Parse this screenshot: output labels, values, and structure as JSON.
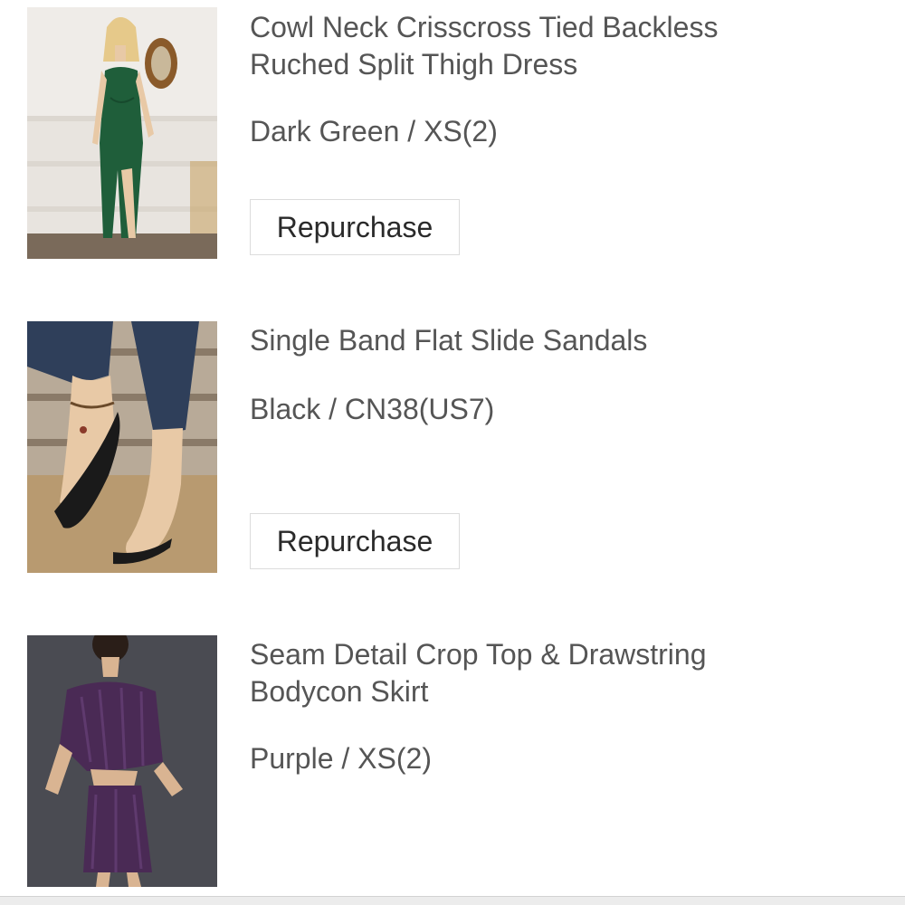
{
  "orders": {
    "items": [
      {
        "title_line1": "Cowl Neck Crisscross Tied Backless",
        "title_line2": "Ruched Split Thigh Dress",
        "variant": "Dark Green / XS(2)",
        "button_label": "Repurchase"
      },
      {
        "title_line1": "Single Band Flat Slide Sandals",
        "title_line2": "",
        "variant": "Black / CN38(US7)",
        "button_label": "Repurchase"
      },
      {
        "title_line1": "Seam Detail Crop Top & Drawstring",
        "title_line2": "Bodycon Skirt",
        "variant": "Purple / XS(2)",
        "button_label": ""
      }
    ]
  },
  "colors": {
    "text": "#555555",
    "button_text": "#2a2a2a",
    "button_border": "#dcdcdc",
    "dress": "#1f5e3a",
    "sandal": "#1a1a1a",
    "outfit": "#4a2a55"
  }
}
